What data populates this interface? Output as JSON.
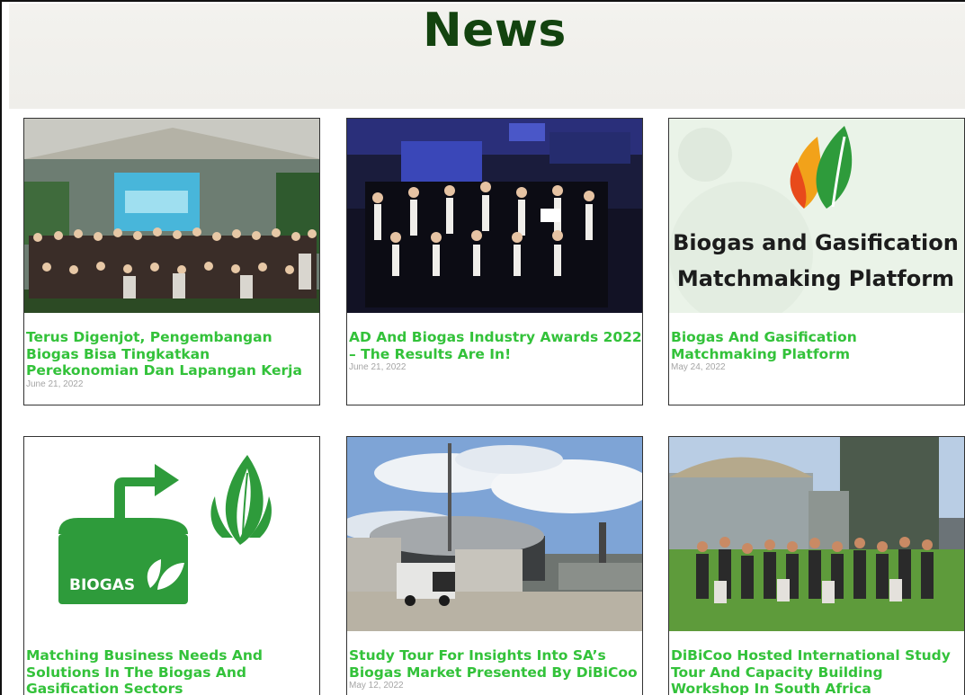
{
  "page": {
    "title": "News"
  },
  "cards": [
    {
      "title": "Terus Digenjot, Pengembangan Biogas Bisa Tingkatkan Perekonomian Dan Lapangan Kerja",
      "date": "June 21, 2022",
      "image": "conference-group-photo"
    },
    {
      "title": "AD And Biogas Industry Awards 2022 – The Results Are In!",
      "date": "June 21, 2022",
      "image": "awards-ceremony-photo"
    },
    {
      "title": "Biogas And Gasification Matchmaking Platform",
      "date": "May 24, 2022",
      "image": "matchmaking-platform-banner",
      "banner_lines": [
        "Biogas and Gasification",
        "Matchmaking Platform"
      ]
    },
    {
      "title": "Matching Business Needs And Solutions In The Biogas And Gasification Sectors",
      "date": "",
      "image": "biogas-tank-illustration",
      "tank_label": "BIOGAS"
    },
    {
      "title": "Study Tour For Insights Into SA’s Biogas Market Presented By DiBiCoo",
      "date": "May 12, 2022",
      "image": "biogas-plant-photo"
    },
    {
      "title": "DiBiCoo Hosted International Study Tour And Capacity Building Workshop In South Africa",
      "date": "",
      "image": "study-tour-group-photo"
    }
  ],
  "colors": {
    "title_green": "#13430f",
    "link_green": "#33c23a",
    "date_gray": "#a5a5a5"
  }
}
